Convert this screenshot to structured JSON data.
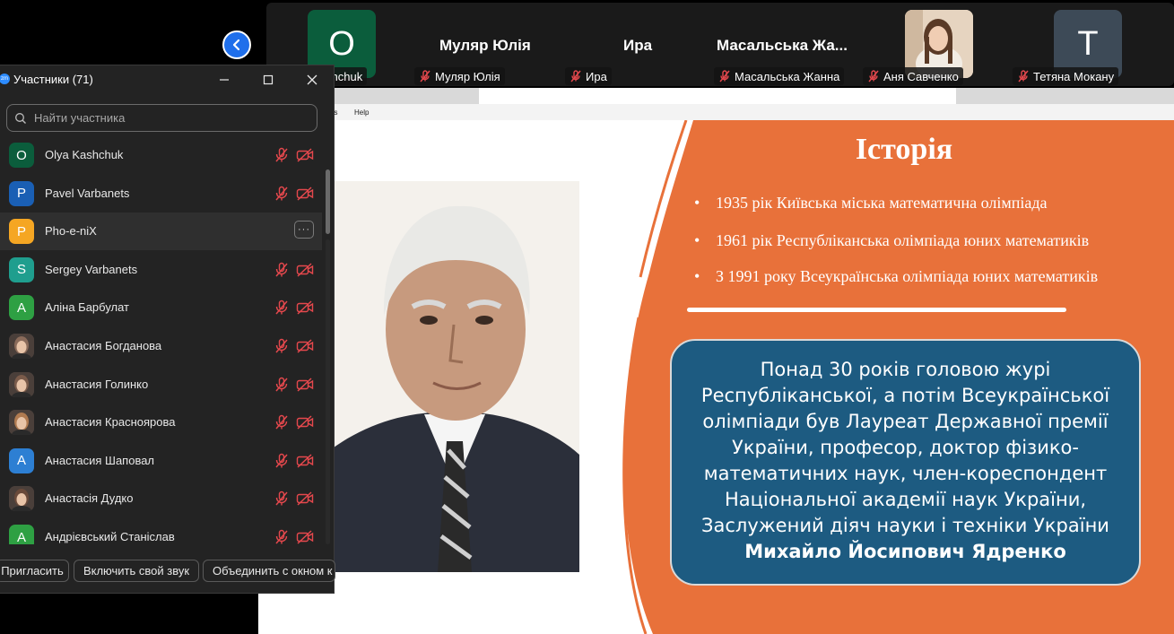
{
  "top_strip": {
    "tiles": [
      {
        "kind": "letter",
        "letter": "O",
        "bg": "#0b5d3c"
      },
      {
        "kind": "name",
        "name": "Муляр Юлія"
      },
      {
        "kind": "name",
        "name": "Ира"
      },
      {
        "kind": "name",
        "name": "Масальська  Жа..."
      },
      {
        "kind": "photo"
      },
      {
        "kind": "letter",
        "letter": "T",
        "bg": "#3d4a57"
      }
    ],
    "captions": [
      {
        "name": "shchuk",
        "muted": false
      },
      {
        "name": "Муляр Юлія",
        "muted": true
      },
      {
        "name": "Ира",
        "muted": true
      },
      {
        "name": "Масальська Жанна",
        "muted": true
      },
      {
        "name": "Аня Савченко",
        "muted": true
      },
      {
        "name": "Тетяна Мокану",
        "muted": true
      }
    ]
  },
  "shared_app": {
    "menu_fragment": "es",
    "menu_help": "Help"
  },
  "slide": {
    "title": "Історія",
    "bullets": [
      "1935 рік Київська міська математична олімпіада",
      "1961 рік Республіканська олімпіада юних математиків",
      "З 1991 року Всеукраїнська олімпіада юних математиків"
    ],
    "bullet_char": "•",
    "info_lines": [
      "Понад 30 років головою журі",
      "Республіканської, а потім Всеукраїнської",
      "олімпіади був Лауреат Державної премії",
      "України, професор, доктор фізико-",
      "математичних наук, член-кореспондент",
      "Національної академії наук України,",
      "Заслужений діяч науки і техніки України"
    ],
    "info_name": "Михайло Йосипович Ядренко",
    "colors": {
      "orange": "#e8713a",
      "box": "#1d5b81"
    }
  },
  "panel": {
    "logo": "zm",
    "title": "Участники (71)",
    "search_placeholder": "Найти участника",
    "participants": [
      {
        "name": "Olya Kashchuk",
        "avatar": "O",
        "color": "#0b5d3c",
        "state": "muted"
      },
      {
        "name": "Pavel Varbanets",
        "avatar": "P",
        "color": "#1a5fb4",
        "state": "muted"
      },
      {
        "name": "Pho-e-niX",
        "avatar": "P",
        "color": "#f5a623",
        "state": "hover"
      },
      {
        "name": "Sergey Varbanets",
        "avatar": "S",
        "color": "#1f9e8e",
        "state": "muted"
      },
      {
        "name": "Аліна Барбулат",
        "avatar": "A",
        "color": "#2ea043",
        "state": "muted"
      },
      {
        "name": "Анастасия Богданова",
        "avatar": "photo",
        "color": "#8a6b5a",
        "state": "muted"
      },
      {
        "name": "Анастасия Голинко",
        "avatar": "photo",
        "color": "#7a5b4a",
        "state": "muted"
      },
      {
        "name": "Анастасия Красноярова",
        "avatar": "photo",
        "color": "#b07a50",
        "state": "muted"
      },
      {
        "name": "Анастасия Шаповал",
        "avatar": "A",
        "color": "#2d7fd3",
        "state": "muted"
      },
      {
        "name": "Анастасія Дудко",
        "avatar": "photo",
        "color": "#6a4a3a",
        "state": "muted"
      },
      {
        "name": "Андрієвський Станіслав",
        "avatar": "A",
        "color": "#2ea043",
        "state": "muted"
      }
    ],
    "buttons": {
      "invite": "Пригласить",
      "unmute": "Включить свой звук",
      "merge": "Объединить с окном к"
    }
  }
}
